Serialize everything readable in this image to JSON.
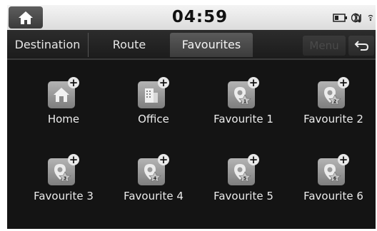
{
  "status": {
    "time": "04:59"
  },
  "tabs": [
    {
      "label": "Destination",
      "active": false
    },
    {
      "label": "Route",
      "active": false
    },
    {
      "label": "Favourites",
      "active": true
    }
  ],
  "toolbar": {
    "menu_label": "Menu"
  },
  "favourites": [
    {
      "label": "Home",
      "icon": "home-icon"
    },
    {
      "label": "Office",
      "icon": "office-icon"
    },
    {
      "label": "Favourite 1",
      "icon": "location-pin-icon",
      "number": "1"
    },
    {
      "label": "Favourite 2",
      "icon": "location-pin-icon",
      "number": "2"
    },
    {
      "label": "Favourite 3",
      "icon": "location-pin-icon",
      "number": "3"
    },
    {
      "label": "Favourite 4",
      "icon": "location-pin-icon",
      "number": "4"
    },
    {
      "label": "Favourite 5",
      "icon": "location-pin-icon",
      "number": "5"
    },
    {
      "label": "Favourite 6",
      "icon": "location-pin-icon",
      "number": "6"
    }
  ],
  "colors": {
    "background": "#141414",
    "statusbar": "#e8e8e8",
    "tile": "#9a9a9a"
  }
}
